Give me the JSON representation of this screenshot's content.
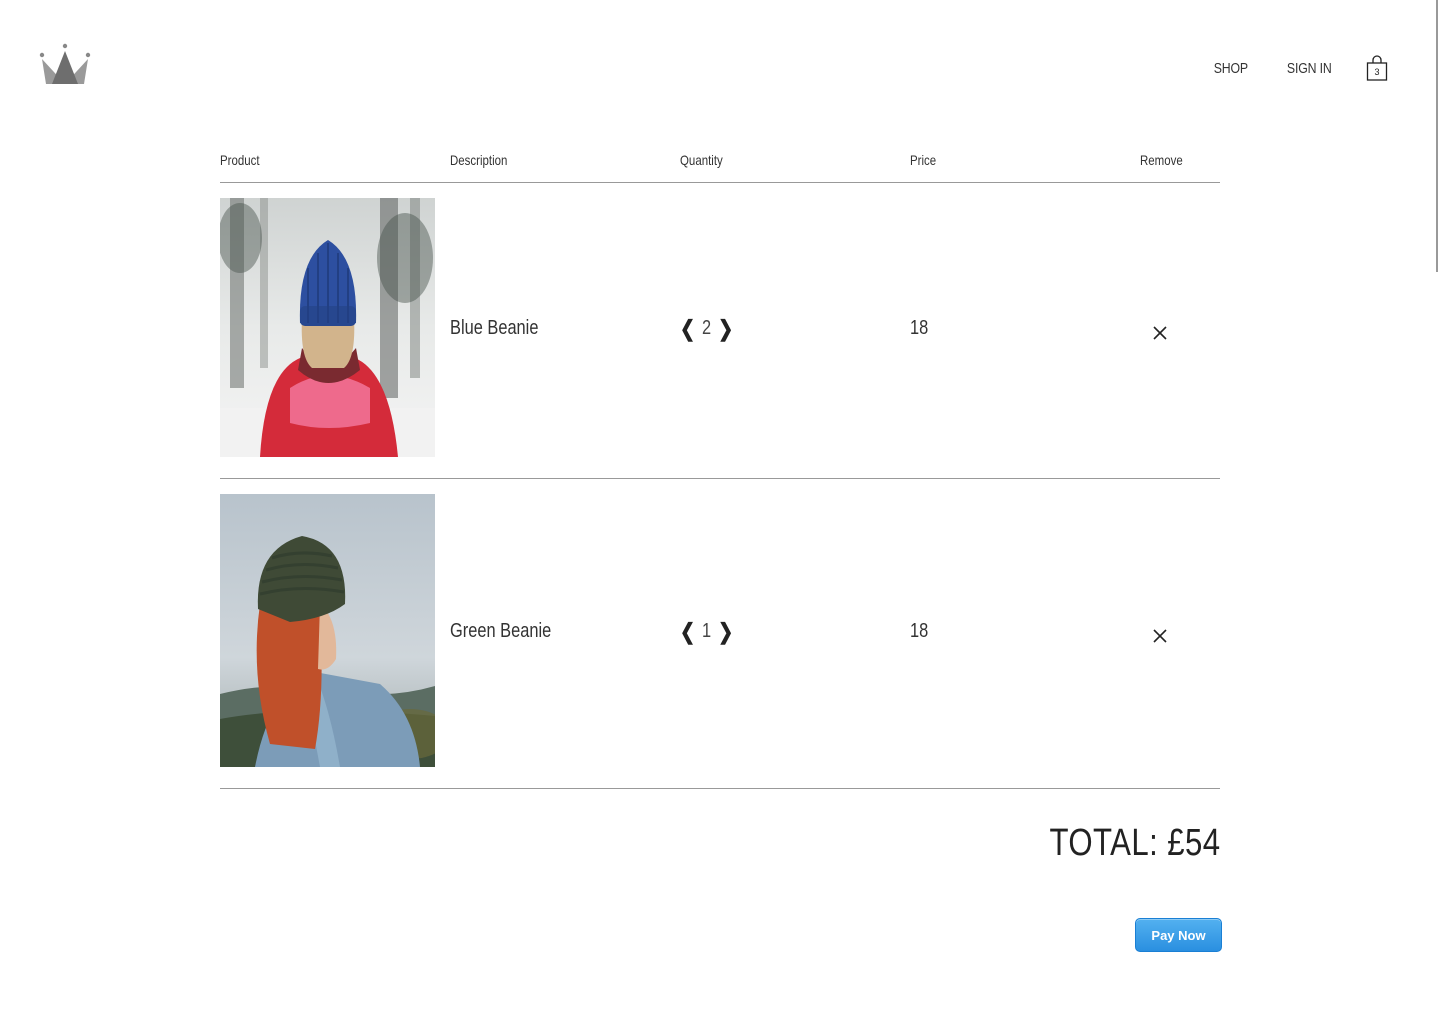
{
  "header": {
    "logo_icon": "crown-icon",
    "nav": {
      "shop_label": "SHOP",
      "signin_label": "SIGN IN",
      "cart_icon": "shopping-bag-icon",
      "cart_count": "3"
    }
  },
  "cart": {
    "columns": {
      "product": "Product",
      "description": "Description",
      "quantity": "Quantity",
      "price": "Price",
      "remove": "Remove"
    },
    "items": [
      {
        "image_icon": "blue-beanie-photo",
        "description": "Blue Beanie",
        "quantity": "2",
        "price": "18",
        "decrease_icon": "chevron-left-icon",
        "increase_icon": "chevron-right-icon",
        "remove_icon": "close-icon"
      },
      {
        "image_icon": "green-beanie-photo",
        "description": "Green Beanie",
        "quantity": "1",
        "price": "18",
        "decrease_icon": "chevron-left-icon",
        "increase_icon": "chevron-right-icon",
        "remove_icon": "close-icon"
      }
    ],
    "total_label": "TOTAL: £54",
    "pay_button_label": "Pay Now"
  },
  "colors": {
    "accent": "#2a8fe0",
    "divider": "#999999",
    "text": "#333333"
  }
}
